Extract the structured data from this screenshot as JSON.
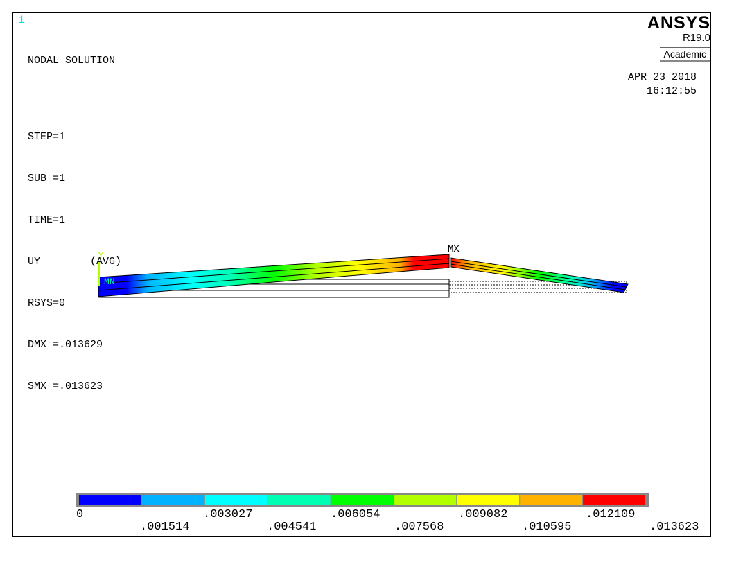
{
  "window": {
    "number": "1"
  },
  "info": {
    "title": "NODAL SOLUTION",
    "lines": [
      "STEP=1",
      "SUB =1",
      "TIME=1",
      "UY        (AVG)",
      "RSYS=0",
      "DMX =.013629",
      "SMX =.013623"
    ]
  },
  "brand": {
    "name": "ANSYS",
    "version": "R19.0",
    "edition": "Academic"
  },
  "datetime": {
    "date": "APR 23 2018",
    "time": "16:12:55"
  },
  "plot": {
    "axis_label": "Y",
    "max_label": "MX",
    "min_label": "MN"
  },
  "legend": {
    "colors": [
      "#0000ff",
      "#00b2ff",
      "#00ffff",
      "#00ffb2",
      "#00ff00",
      "#b2ff00",
      "#ffff00",
      "#ffb200",
      "#ff0000"
    ],
    "labels_top": [
      "0",
      ".003027",
      ".006054",
      ".009082",
      ".012109"
    ],
    "labels_bottom": [
      ".001514",
      ".004541",
      ".007568",
      ".010595",
      ".013623"
    ]
  }
}
